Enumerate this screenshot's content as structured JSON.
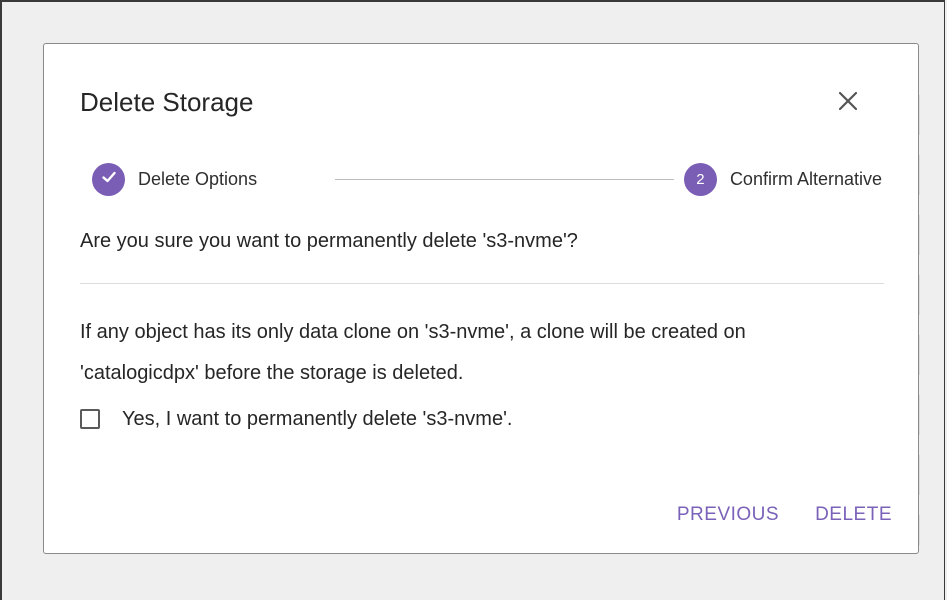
{
  "dialog": {
    "title": "Delete Storage"
  },
  "stepper": {
    "steps": [
      {
        "label": "Delete Options",
        "state": "completed",
        "icon": "check-icon"
      },
      {
        "number": "2",
        "label": "Confirm Alternative",
        "state": "active"
      }
    ]
  },
  "content": {
    "confirm_question": "Are you sure you want to permanently delete 's3-nvme'?",
    "info_line_1": "If any object has its only data clone on 's3-nvme', a clone will be created on",
    "info_line_2": "'catalogicdpx' before the storage is deleted.",
    "checkbox_label": "Yes, I want to permanently delete 's3-nvme'.",
    "checkbox_checked": false
  },
  "actions": {
    "previous_label": "PREVIOUS",
    "delete_label": "DELETE"
  },
  "colors": {
    "accent": "#7a5db4",
    "button_text": "#7a62b8",
    "backdrop": "#efefef"
  }
}
